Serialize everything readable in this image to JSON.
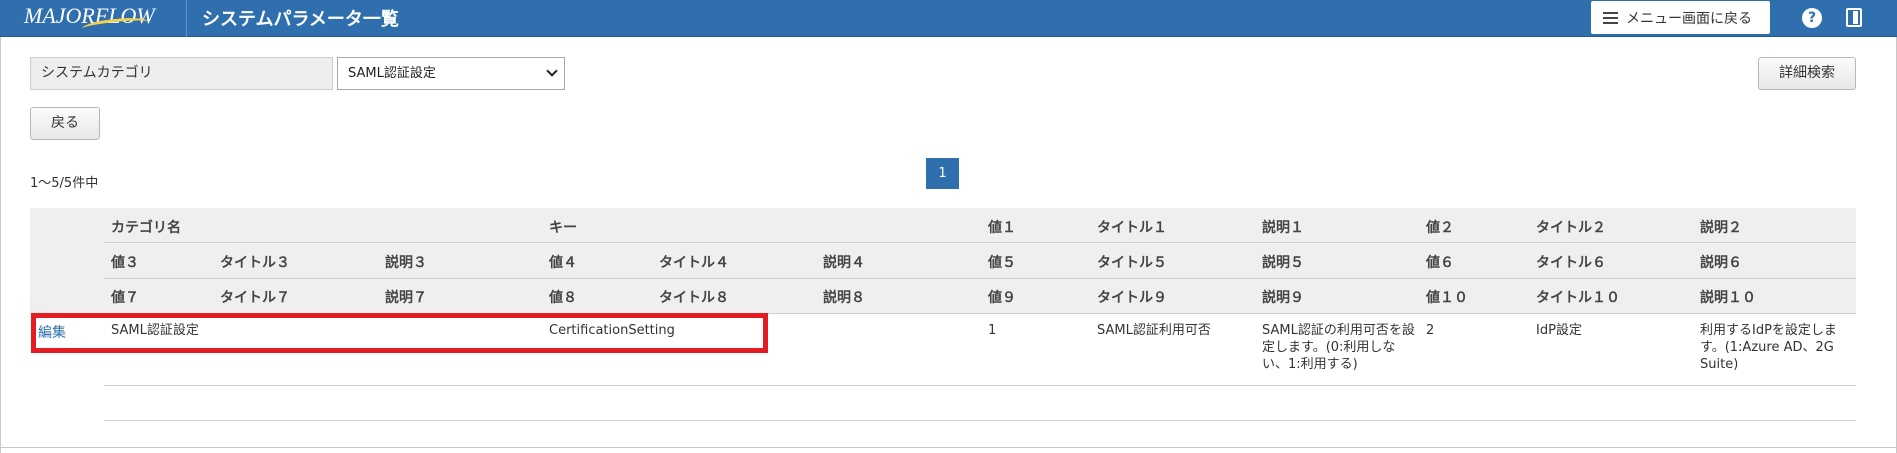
{
  "header": {
    "logo": "MAJORFLOW",
    "title": "システムパラメータ一覧",
    "menu_return": "メニュー画面に戻る",
    "help_icon": "?"
  },
  "filter": {
    "category_label": "システムカテゴリ",
    "category_selected": "SAML認証設定",
    "detail_search": "詳細検索",
    "back": "戻る"
  },
  "pager": {
    "count": "1〜5/5件中",
    "current_page": "1"
  },
  "table": {
    "header_rows": [
      [
        "カテゴリ名",
        "キー",
        "値１",
        "タイトル１",
        "説明１",
        "値２",
        "タイトル２",
        "説明２"
      ],
      [
        "値３",
        "タイトル３",
        "説明３",
        "値４",
        "タイトル４",
        "説明４",
        "値５",
        "タイトル５",
        "説明５",
        "値６",
        "タイトル６",
        "説明６"
      ],
      [
        "値７",
        "タイトル７",
        "説明７",
        "値８",
        "タイトル８",
        "説明８",
        "値９",
        "タイトル９",
        "説明９",
        "値１０",
        "タイトル１０",
        "説明１０"
      ]
    ],
    "rows": [
      {
        "edit": "編集",
        "category": "SAML認証設定",
        "key": "CertificationSetting",
        "value1": "1",
        "title1": "SAML認証利用可否",
        "desc1": "SAML認証の利用可否を設定します。(0:利用しない、1:利用する)",
        "value2": "2",
        "title2": "IdP設定",
        "desc2": "利用するIdPを設定します。(1:Azure AD、2G Suite)"
      }
    ]
  },
  "colors": {
    "header_bg": "#2f6fae",
    "highlight": "#e41d25",
    "table_header_bg": "#efefef"
  }
}
